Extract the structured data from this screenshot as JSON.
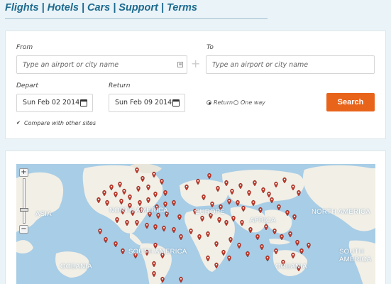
{
  "nav": {
    "items": [
      "Flights",
      "Hotels",
      "Cars",
      "Support",
      "Terms"
    ],
    "separator": "|"
  },
  "search": {
    "from_label": "From",
    "to_label": "To",
    "from_placeholder": "Type an airport or city name",
    "to_placeholder": "Type an airport or city name",
    "depart_label": "Depart",
    "return_label": "Return",
    "depart_value": "Sun Feb 02 2014",
    "return_value": "Sun Feb 09 2014",
    "trip_options": [
      "Return",
      "One way"
    ],
    "trip_selected": "Return",
    "search_button": "Search",
    "compare_label": "Compare with other sites",
    "compare_checked": true
  },
  "map": {
    "labels": [
      "ASIA",
      "NORTH AMERICA",
      "EUROPE",
      "AFRICA",
      "NORTH AMERICA",
      "OCEANIA",
      "SOUTH AMERICA",
      "OCEANIA",
      "SOUTH AMERICA"
    ],
    "zoom_in": "+",
    "zoom_out": "−",
    "marker_color": "#c0392b",
    "land_color": "#f2efe6",
    "water_color": "#a8cde6"
  },
  "colors": {
    "nav": "#1e6a8e",
    "search_button": "#e8641b",
    "background": "#e9f3f8"
  }
}
